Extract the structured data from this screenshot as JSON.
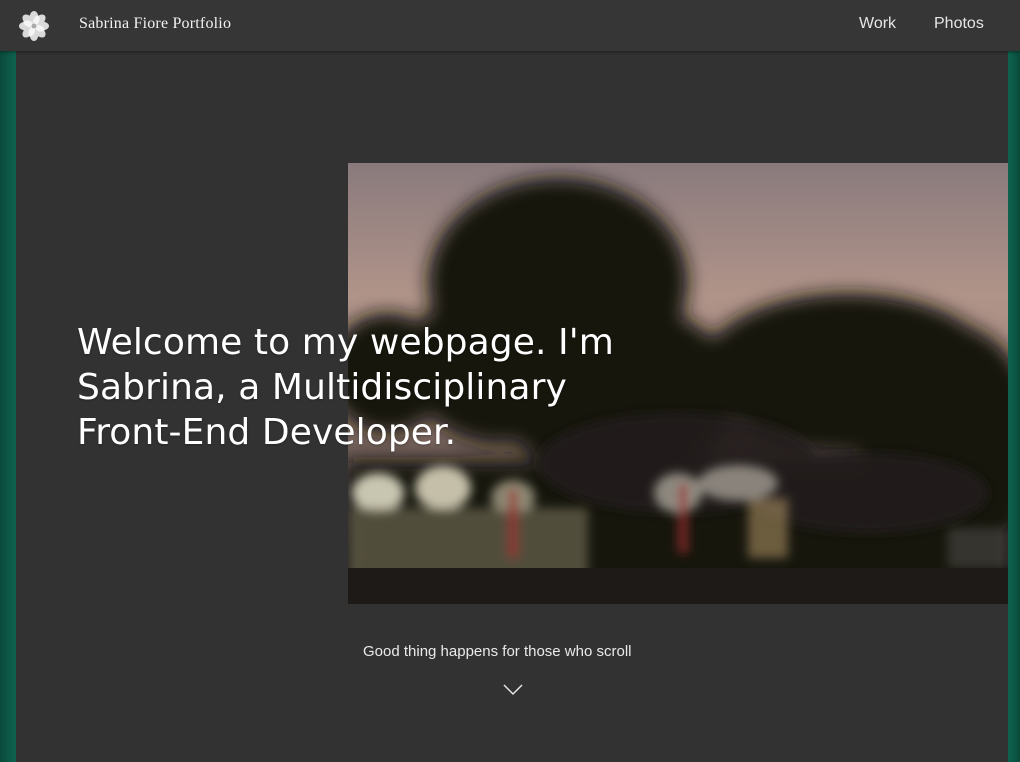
{
  "header": {
    "brand": "Sabrina Fiore Portfolio",
    "logo_icon": "flower-logo-icon",
    "nav": [
      {
        "label": "Work"
      },
      {
        "label": "Photos"
      }
    ]
  },
  "hero": {
    "headline": "Welcome to my webpage. I'm Sabrina, a Multidisciplinary Front-End Developer.",
    "photo_description_icon": "blurred-night-trees-photo",
    "scroll_hint": "Good thing happens for those who scroll",
    "scroll_icon": "chevron-down-icon"
  },
  "colors": {
    "background": "#323232",
    "header": "#363636",
    "accent_stripe": "#0d5a48",
    "text": "#ffffff"
  }
}
